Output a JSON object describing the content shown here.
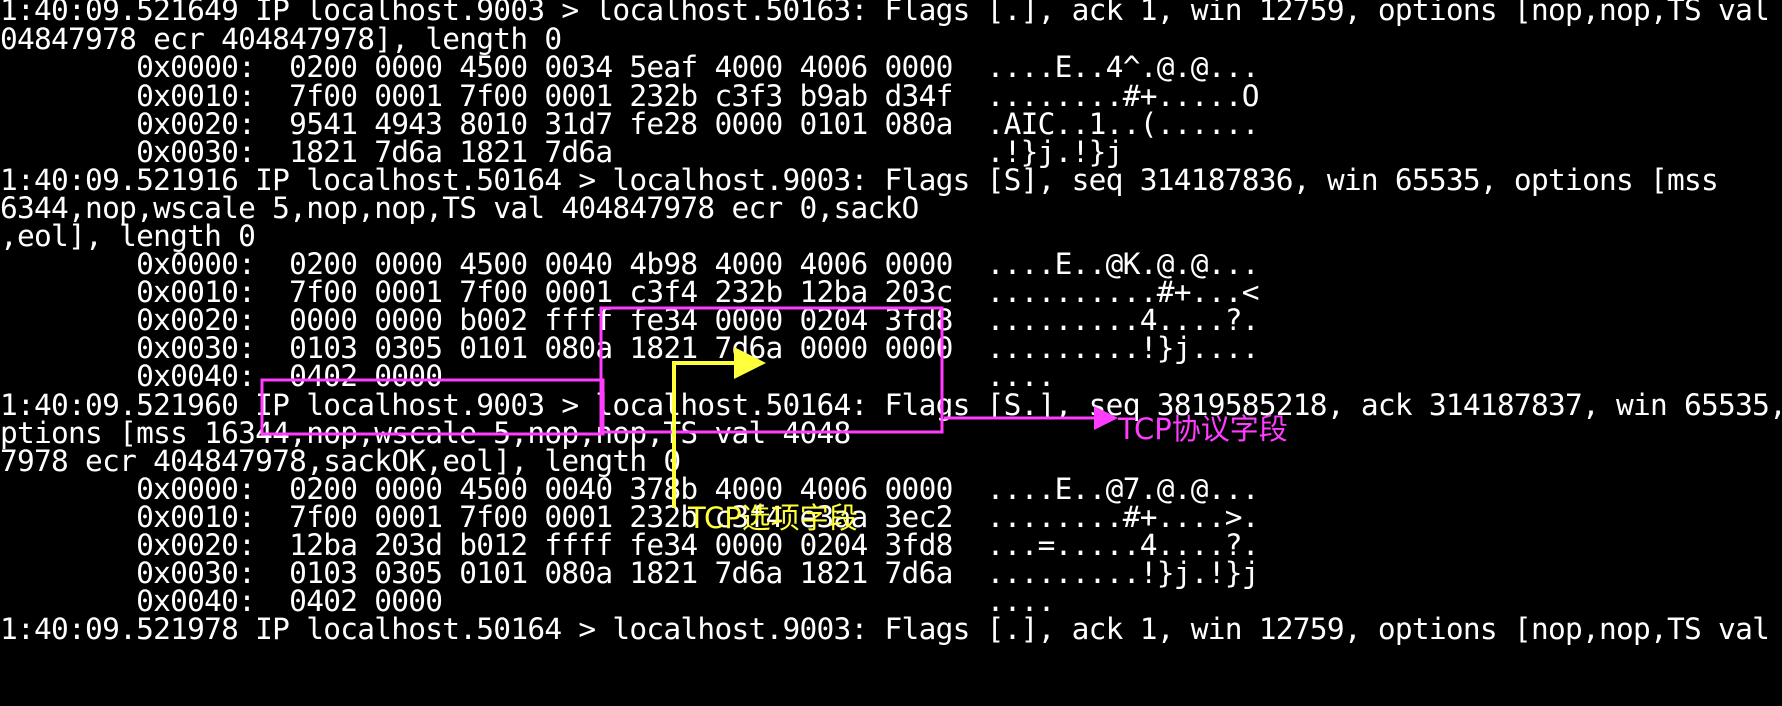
{
  "terminal": {
    "lines": [
      "1:40:09.521649 IP localhost.9003 > localhost.50163: Flags [.], ack 1, win 12759, options [nop,nop,TS val",
      "04847978 ecr 404847978], length 0",
      "        0x0000:  0200 0000 4500 0034 5eaf 4000 4006 0000  ....E..4^.@.@...",
      "        0x0010:  7f00 0001 7f00 0001 232b c3f3 b9ab d34f  ........#+.....O",
      "        0x0020:  9541 4943 8010 31d7 fe28 0000 0101 080a  .AIC..1..(......",
      "        0x0030:  1821 7d6a 1821 7d6a                      .!}j.!}j",
      "1:40:09.521916 IP localhost.50164 > localhost.9003: Flags [S], seq 314187836, win 65535, options [mss",
      "6344,nop,wscale 5,nop,nop,TS val 404847978 ecr 0,sackO",
      ",eol], length 0",
      "        0x0000:  0200 0000 4500 0040 4b98 4000 4006 0000  ....E..@K.@.@...",
      "        0x0010:  7f00 0001 7f00 0001 c3f4 232b 12ba 203c  ..........#+...<",
      "        0x0020:  0000 0000 b002 ffff fe34 0000 0204 3fd8  .........4....?.",
      "        0x0030:  0103 0305 0101 080a 1821 7d6a 0000 0000  .........!}j....",
      "        0x0040:  0402 0000                                ....",
      "1:40:09.521960 IP localhost.9003 > localhost.50164: Flags [S.], seq 3819585218, ack 314187837, win 65535,",
      "ptions [mss 16344,nop,wscale 5,nop,nop,TS val 4048",
      "7978 ecr 404847978,sackOK,eol], length 0",
      "        0x0000:  0200 0000 4500 0040 378b 4000 4006 0000  ....E..@7.@.@...",
      "        0x0010:  7f00 0001 7f00 0001 232b c3f4 e3aa 3ec2  ........#+....>.",
      "        0x0020:  12ba 203d b012 ffff fe34 0000 0204 3fd8  ...=.....4....?.",
      "        0x0030:  0103 0305 0101 080a 1821 7d6a 1821 7d6a  .........!}j.!}j",
      "        0x0040:  0402 0000                                ....",
      "1:40:09.521978 IP localhost.50164 > localhost.9003: Flags [.], ack 1, win 12759, options [nop,nop,TS val"
    ]
  },
  "annotations": {
    "tcp_protocol_label": "TCP协议字段",
    "tcp_options_label": "TCP选项字段"
  },
  "colors": {
    "background": "#000000",
    "text": "#ffffff",
    "protocol_highlight": "#ff3cff",
    "options_highlight": "#ffff3c"
  }
}
